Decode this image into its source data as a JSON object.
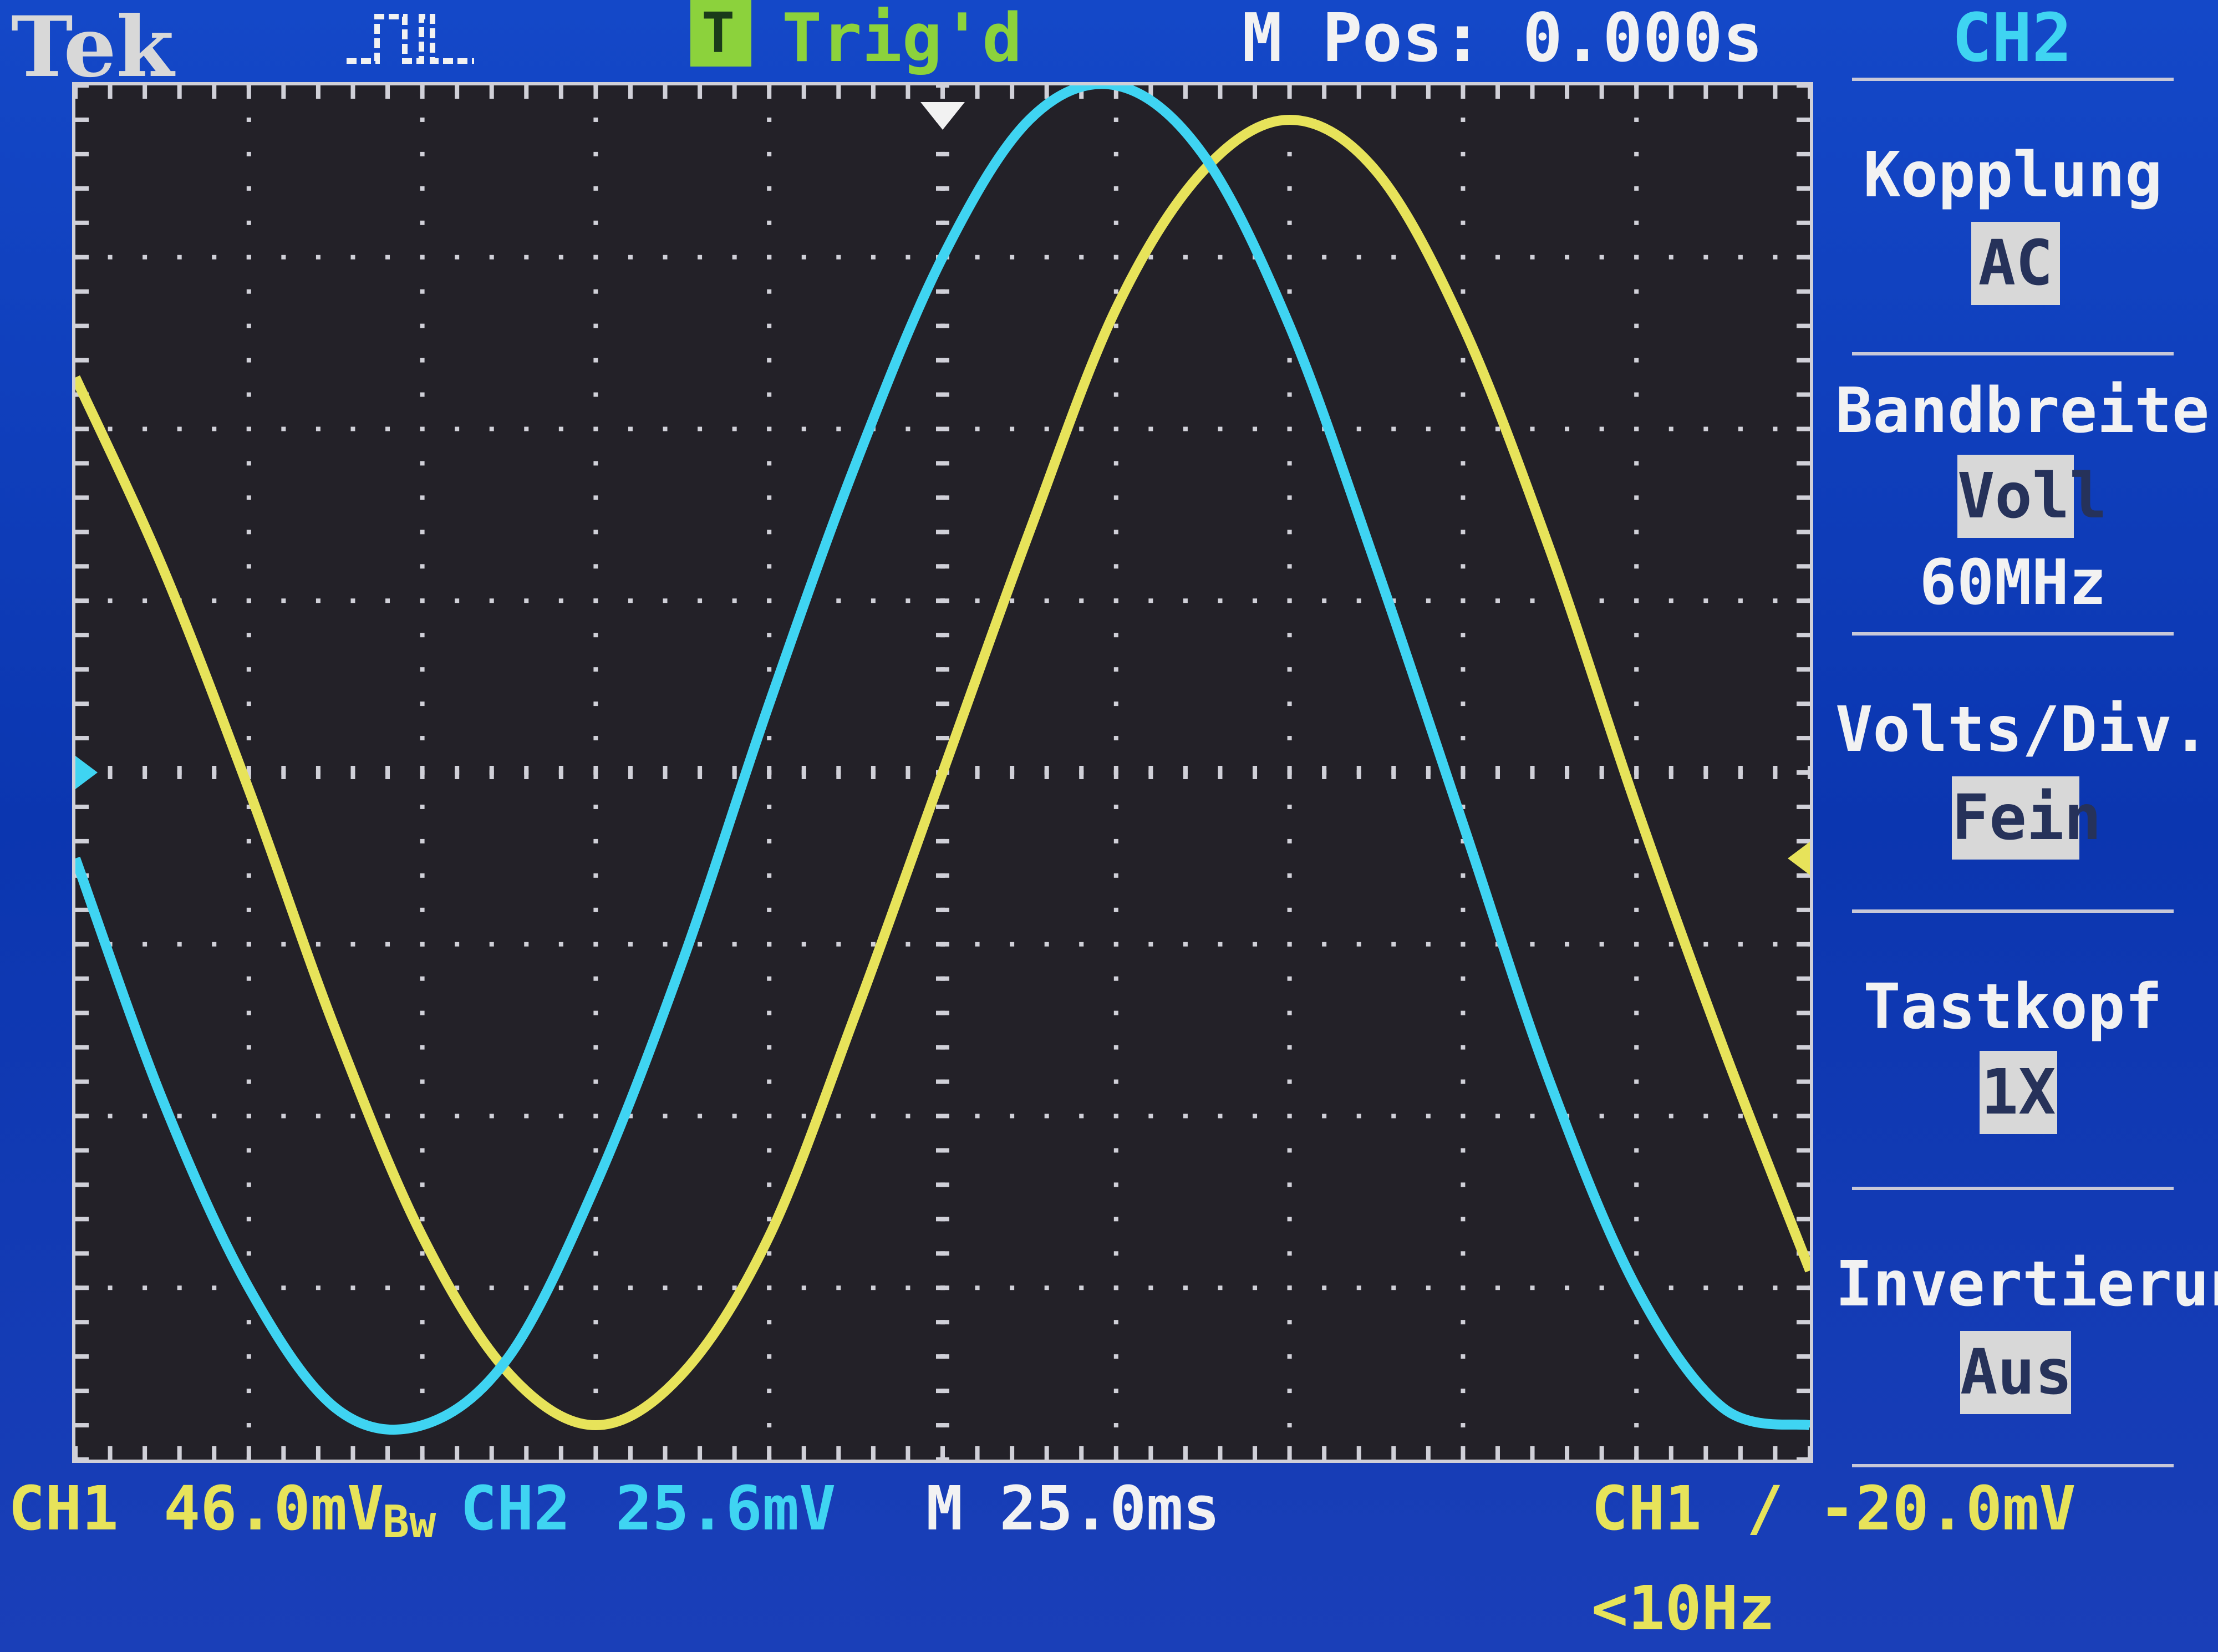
{
  "header": {
    "brand": "Tek",
    "trigger_status": "Trig'd",
    "trigger_icon_letter": "T",
    "horizontal_position": "M Pos: 0.000s",
    "channel": "CH2"
  },
  "menu": {
    "coupling_label": "Kopplung",
    "coupling_value": "AC",
    "bandwidth_label": "Bandbreite",
    "bandwidth_value": "Voll",
    "bandwidth_freq": "60MHz",
    "volts_div_label": "Volts/Div.",
    "volts_div_value": "Fein",
    "probe_label": "Tastkopf",
    "probe_value": "1X",
    "invert_label": "Invertierung",
    "invert_value": "Aus"
  },
  "status": {
    "ch1_label": "CH1",
    "ch1_scale": "46.0mV",
    "bw_marker": "Bw",
    "ch2_label": "CH2",
    "ch2_scale": "25.6mV",
    "timebase": "M 25.0ms",
    "trigger_source": "CH1",
    "trigger_slope": "/",
    "trigger_level": "-20.0mV",
    "trigger_freq": "<10Hz"
  },
  "colors": {
    "ch1": "#e7e35a",
    "ch2": "#3fd4f2",
    "grid": "#d0d0d8",
    "plot_bg": "#232128"
  },
  "chart_data": {
    "type": "line",
    "grid_divisions": {
      "x": 10,
      "y": 8
    },
    "x_unit": "div",
    "y_unit": "div",
    "series": [
      {
        "name": "CH1",
        "color": "#e7e35a",
        "x": [
          0,
          0.5,
          1,
          1.5,
          2,
          2.5,
          3,
          3.5,
          4,
          4.5,
          5,
          5.5,
          6,
          6.5,
          7,
          7.5,
          8,
          8.5,
          9,
          9.5,
          10
        ],
        "y": [
          2.3,
          1.2,
          -0.1,
          -1.5,
          -2.7,
          -3.5,
          -3.8,
          -3.5,
          -2.7,
          -1.4,
          0.0,
          1.4,
          2.7,
          3.5,
          3.8,
          3.5,
          2.6,
          1.3,
          -0.2,
          -1.6,
          -2.9
        ]
      },
      {
        "name": "CH2",
        "color": "#3fd4f2",
        "x": [
          0,
          0.5,
          1,
          1.5,
          2,
          2.5,
          3,
          3.5,
          4,
          4.5,
          5,
          5.5,
          6,
          6.5,
          7,
          7.5,
          8,
          8.5,
          9,
          9.5,
          10
        ],
        "y": [
          -0.5,
          -1.9,
          -3.0,
          -3.7,
          -3.8,
          -3.4,
          -2.4,
          -1.1,
          0.4,
          1.8,
          3.0,
          3.8,
          4.0,
          3.6,
          2.6,
          1.2,
          -0.3,
          -1.8,
          -3.0,
          -3.7,
          -3.8
        ]
      }
    ]
  }
}
